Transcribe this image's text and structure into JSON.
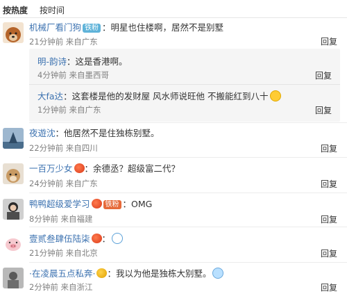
{
  "sort": {
    "hot": "按热度",
    "time": "按时间"
  },
  "c1": {
    "user": "机械厂看门狗",
    "badge": "铁粉",
    "text": "：明星也住楼啊，居然不是别墅",
    "time": "21分钟前",
    "source": "来自广东",
    "reply": "回复",
    "replies": [
      {
        "user": "明-韵诗",
        "text": "：这是香港啊。",
        "time": "4分钟前",
        "source": "来自墨西哥",
        "reply": "回复"
      },
      {
        "user": "大fa达",
        "text": "：这套楼是他的发财屋 风水师说旺他 不搬能红到八十",
        "time": "1分钟前",
        "source": "来自广东",
        "reply": "回复"
      }
    ]
  },
  "c2": {
    "user": "夜遊沈",
    "text": "：他居然不是住独栋别墅。",
    "time": "22分钟前",
    "source": "来自四川",
    "reply": "回复"
  },
  "c3": {
    "user": "一百万少女",
    "text": "：余德丞？超级富二代？",
    "time": "24分钟前",
    "source": "来自广东",
    "reply": "回复"
  },
  "c4": {
    "user": "鸭鸭超级爱学习",
    "badge": "铁粉",
    "text": "：OMG",
    "time": "8分钟前",
    "source": "来自福建",
    "reply": "回复"
  },
  "c5": {
    "user": "壹贰叁肆伍陆柒",
    "text": "：",
    "time": "21分钟前",
    "source": "来自北京",
    "reply": "回复"
  },
  "c6": {
    "user": "·在凌晨五点私奔·",
    "text": "：我以为他是独栋大别墅。",
    "time": "2分钟前",
    "source": "来自浙江",
    "reply": "回复"
  },
  "colors": {
    "username": "#eb7350",
    "reply_username": "#3c72b0",
    "meta": "#808080"
  },
  "icons": [
    "dog-avatar",
    "iron-fan-badge",
    "vip-badge",
    "grin-emoji",
    "cry-emoji",
    "pig-avatar"
  ]
}
